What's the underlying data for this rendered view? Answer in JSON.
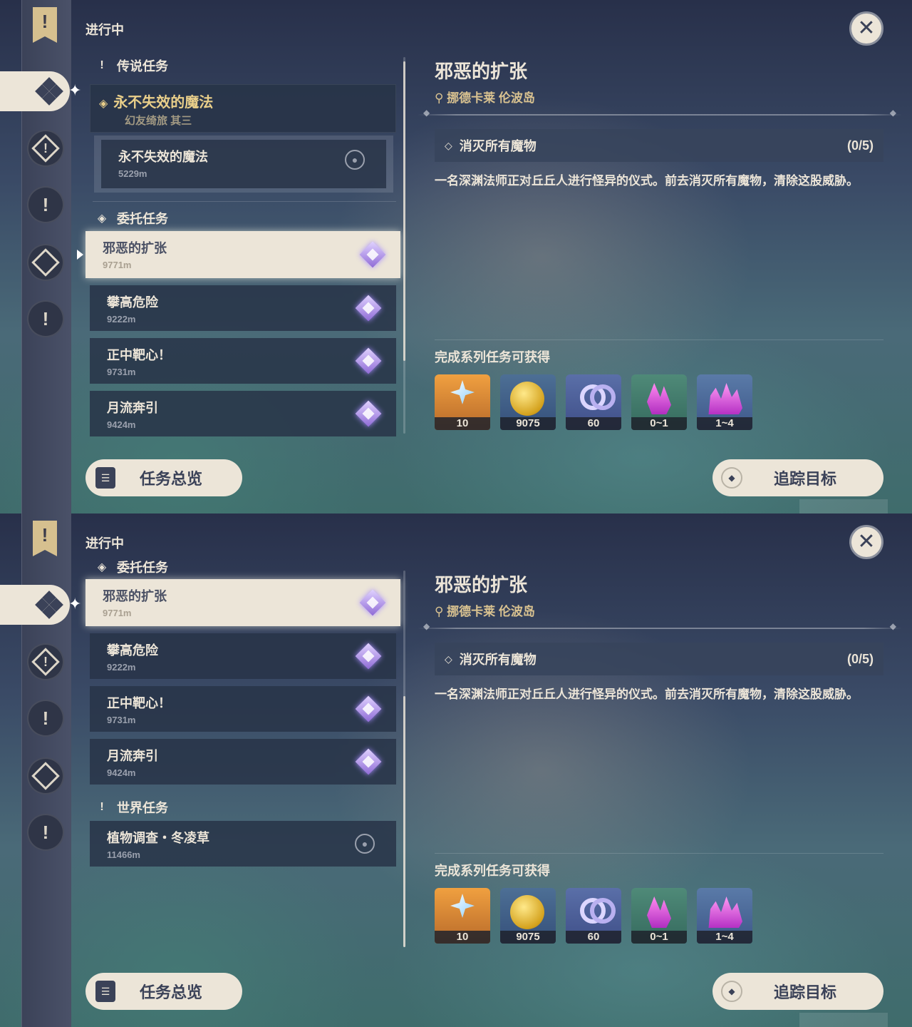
{
  "panels": [
    {
      "header": {
        "in_progress": "进行中"
      },
      "legend_section": {
        "label": "传说任务"
      },
      "legend_quest": {
        "title": "永不失效的魔法",
        "subtitle": "幻友绮旅 其三"
      },
      "legend_sub": {
        "title": "永不失效的魔法",
        "distance": "5229m"
      },
      "commission_section": {
        "label": "委托任务"
      },
      "commissions": [
        {
          "title": "邪恶的扩张",
          "distance": "9771m"
        },
        {
          "title": "攀高危险",
          "distance": "9222m"
        },
        {
          "title": "正中靶心！",
          "distance": "9731m"
        },
        {
          "title": "月流奔引",
          "distance": "9424m"
        }
      ],
      "detail": {
        "title": "邪恶的扩张",
        "location": "挪德卡莱 伦波岛",
        "objective": "消灭所有魔物",
        "objective_count": "(0/5)",
        "description": "一名深渊法师正对丘丘人进行怪异的仪式。前去消灭所有魔物，清除这股威胁。",
        "reward_heading": "完成系列任务可获得",
        "rewards": [
          {
            "icon": "primogem-icon",
            "amount": "10"
          },
          {
            "icon": "mora-icon",
            "amount": "9075"
          },
          {
            "icon": "adventure-exp-icon",
            "amount": "60"
          },
          {
            "icon": "crystal-icon",
            "amount": "0~1"
          },
          {
            "icon": "crystal-cluster-icon",
            "amount": "1~4"
          }
        ]
      },
      "buttons": {
        "overview": "任务总览",
        "track": "追踪目标"
      }
    },
    {
      "header": {
        "in_progress": "进行中"
      },
      "commission_section": {
        "label": "委托任务"
      },
      "commissions": [
        {
          "title": "邪恶的扩张",
          "distance": "9771m"
        },
        {
          "title": "攀高危险",
          "distance": "9222m"
        },
        {
          "title": "正中靶心！",
          "distance": "9731m"
        },
        {
          "title": "月流奔引",
          "distance": "9424m"
        }
      ],
      "world_section": {
        "label": "世界任务"
      },
      "world_quest": {
        "title": "植物调查・冬凌草",
        "distance": "11466m"
      },
      "detail": {
        "title": "邪恶的扩张",
        "location": "挪德卡莱 伦波岛",
        "objective": "消灭所有魔物",
        "objective_count": "(0/5)",
        "description": "一名深渊法师正对丘丘人进行怪异的仪式。前去消灭所有魔物，清除这股威胁。",
        "reward_heading": "完成系列任务可获得",
        "rewards": [
          {
            "icon": "primogem-icon",
            "amount": "10"
          },
          {
            "icon": "mora-icon",
            "amount": "9075"
          },
          {
            "icon": "adventure-exp-icon",
            "amount": "60"
          },
          {
            "icon": "crystal-icon",
            "amount": "0~1"
          },
          {
            "icon": "crystal-cluster-icon",
            "amount": "1~4"
          }
        ]
      },
      "buttons": {
        "overview": "任务总览",
        "track": "追踪目标"
      }
    }
  ]
}
